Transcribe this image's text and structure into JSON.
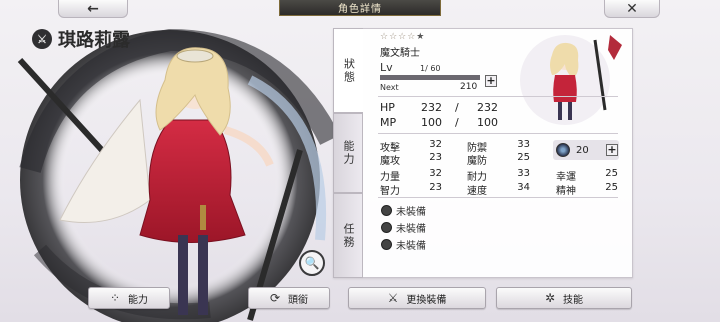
{
  "topbar": {
    "back_glyph": "←",
    "title": "角色詳情",
    "close_glyph": "✕"
  },
  "character": {
    "name": "琪路莉露",
    "stars": "☆☆☆☆",
    "stars_dark": "★",
    "job": "魔文騎士"
  },
  "tabs": {
    "status": "狀態",
    "ability": "能力",
    "mission": "任務"
  },
  "level": {
    "label": "Lv",
    "value": "1/ 60",
    "next_label": "Next",
    "next_value": "210"
  },
  "vitals": {
    "hp_label": "HP",
    "hp_cur": "232",
    "hp_max": "232",
    "mp_label": "MP",
    "mp_cur": "100",
    "mp_max": "100",
    "slash": "/"
  },
  "stats": [
    {
      "label": "攻擊",
      "value": "32"
    },
    {
      "label": "防禦",
      "value": "33"
    },
    {
      "label": "魔攻",
      "value": "23"
    },
    {
      "label": "魔防",
      "value": "25"
    },
    {
      "label": "力量",
      "value": "32"
    },
    {
      "label": "耐力",
      "value": "33"
    },
    {
      "label": "幸運",
      "value": "25"
    },
    {
      "label": "智力",
      "value": "23"
    },
    {
      "label": "速度",
      "value": "34"
    },
    {
      "label": "精神",
      "value": "25"
    }
  ],
  "crystal": {
    "value": "20"
  },
  "equipment": [
    {
      "label": "未裝備",
      "icon": "weapon-icon"
    },
    {
      "label": "未裝備",
      "icon": "armor-icon"
    },
    {
      "label": "未裝備",
      "icon": "accessory-icon"
    }
  ],
  "buttons": {
    "ability": "能力",
    "formation": "頭銜",
    "change_equip": "更換裝備",
    "skills": "技能"
  },
  "colors": {
    "accent_red": "#c4243a",
    "panel_bg": "#ffffff",
    "title_bar": "#2c2b29"
  }
}
